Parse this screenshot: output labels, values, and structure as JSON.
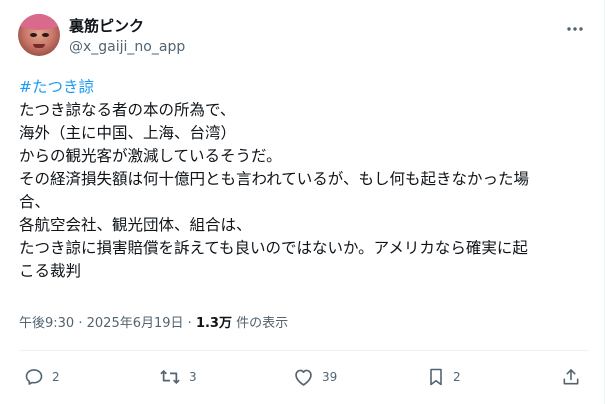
{
  "author": {
    "display_name": "裏筋ピンク",
    "handle": "@x_gaiji_no_app"
  },
  "tweet": {
    "hashtag": "#たつき諒",
    "lines": [
      "たつき諒なる者の本の所為で、",
      "海外（主に中国、上海、台湾）",
      "からの観光客が激減しているそうだ。",
      "その経済損失額は何十億円とも言われているが、もし何も起きなかった場",
      "合、",
      "各航空会社、観光団体、組合は、",
      "たつき諒に損害賠償を訴えても良いのではないか。アメリカなら確実に起",
      "こる裁判"
    ]
  },
  "meta": {
    "time": "午後9:30",
    "separator": "·",
    "date": "2025年6月19日",
    "views_count": "1.3万",
    "views_label": "件の表示"
  },
  "actions": {
    "reply_count": "2",
    "retweet_count": "3",
    "like_count": "39",
    "bookmark_count": "2"
  },
  "icons": {
    "more": "more-horizontal-icon",
    "reply": "reply-icon",
    "retweet": "retweet-icon",
    "like": "heart-icon",
    "bookmark": "bookmark-icon",
    "share": "share-icon"
  },
  "colors": {
    "text": "#0f1419",
    "secondary": "#536471",
    "link": "#1d9bf0",
    "divider": "#eff3f4"
  }
}
